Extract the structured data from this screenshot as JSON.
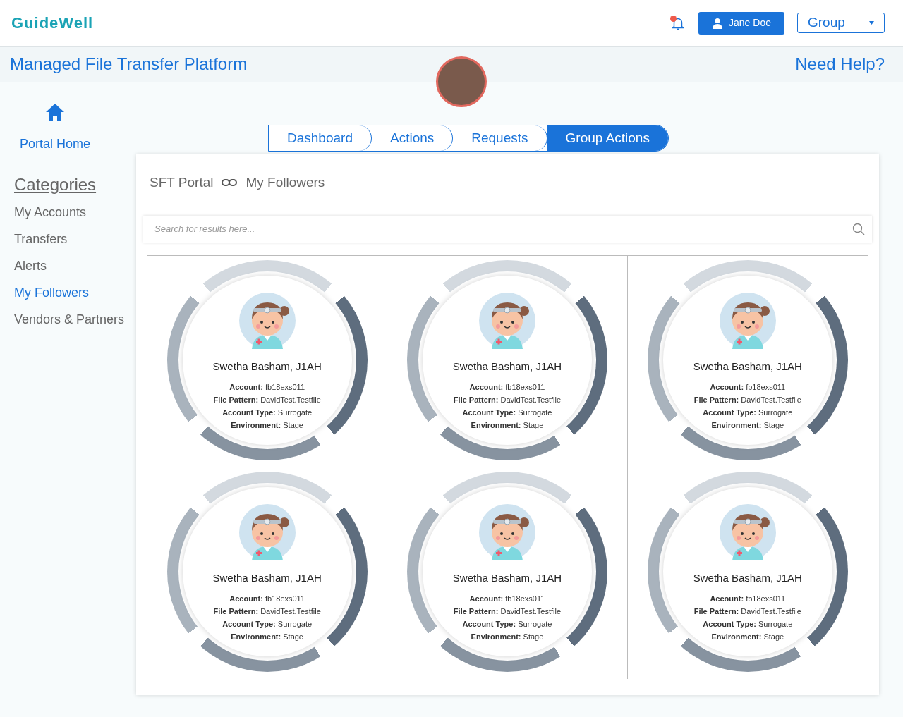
{
  "header": {
    "logo": "GuideWell",
    "notification": true,
    "user_button": "Jane Doe",
    "group_select": "Group"
  },
  "banner": {
    "title": "Managed File Transfer Platform",
    "help": "Need Help?"
  },
  "sidebar": {
    "home_link": "Portal Home",
    "heading": "Categories",
    "items": [
      {
        "label": "My Accounts",
        "selected": false
      },
      {
        "label": "Transfers",
        "selected": false
      },
      {
        "label": "Alerts",
        "selected": false
      },
      {
        "label": "My Followers",
        "selected": true
      },
      {
        "label": "Vendors & Partners",
        "selected": false
      }
    ]
  },
  "tabs": [
    {
      "label": "Dashboard",
      "selected": false
    },
    {
      "label": "Actions",
      "selected": false
    },
    {
      "label": "Requests",
      "selected": false
    },
    {
      "label": "Group Actions",
      "selected": true
    }
  ],
  "breadcrumb": [
    "SFT Portal",
    "My Followers"
  ],
  "search": {
    "placeholder": "Search for results here..."
  },
  "followers": [
    {
      "name": "Swetha Basham, J1AH",
      "details": [
        "**Account:** fb18exs011",
        "**File Pattern:** DavidTest.Testfile",
        "**Account Type:** Surrogate",
        "**Environment:** Stage"
      ]
    },
    {
      "name": "Swetha Basham, J1AH",
      "details": [
        "**Account:** fb18exs011",
        "**File Pattern:** DavidTest.Testfile",
        "**Account Type:** Surrogate",
        "**Environment:** Stage"
      ]
    },
    {
      "name": "Swetha Basham, J1AH",
      "details": [
        "**Account:** fb18exs011",
        "**File Pattern:** DavidTest.Testfile",
        "**Account Type:** Surrogate",
        "**Environment:** Stage"
      ]
    },
    {
      "name": "Swetha Basham, J1AH",
      "details": [
        "**Account:** fb18exs011",
        "**File Pattern:** DavidTest.Testfile",
        "**Account Type:** Surrogate",
        "**Environment:** Stage"
      ]
    },
    {
      "name": "Swetha Basham, J1AH",
      "details": [
        "**Account:** fb18exs011",
        "**File Pattern:** DavidTest.Testfile",
        "**Account Type:** Surrogate",
        "**Environment:** Stage"
      ]
    },
    {
      "name": "Swetha Basham, J1AH",
      "details": [
        "**Account:** fb18exs011",
        "**File Pattern:** DavidTest.Testfile",
        "**Account Type:** Surrogate",
        "**Environment:** Stage"
      ]
    }
  ]
}
